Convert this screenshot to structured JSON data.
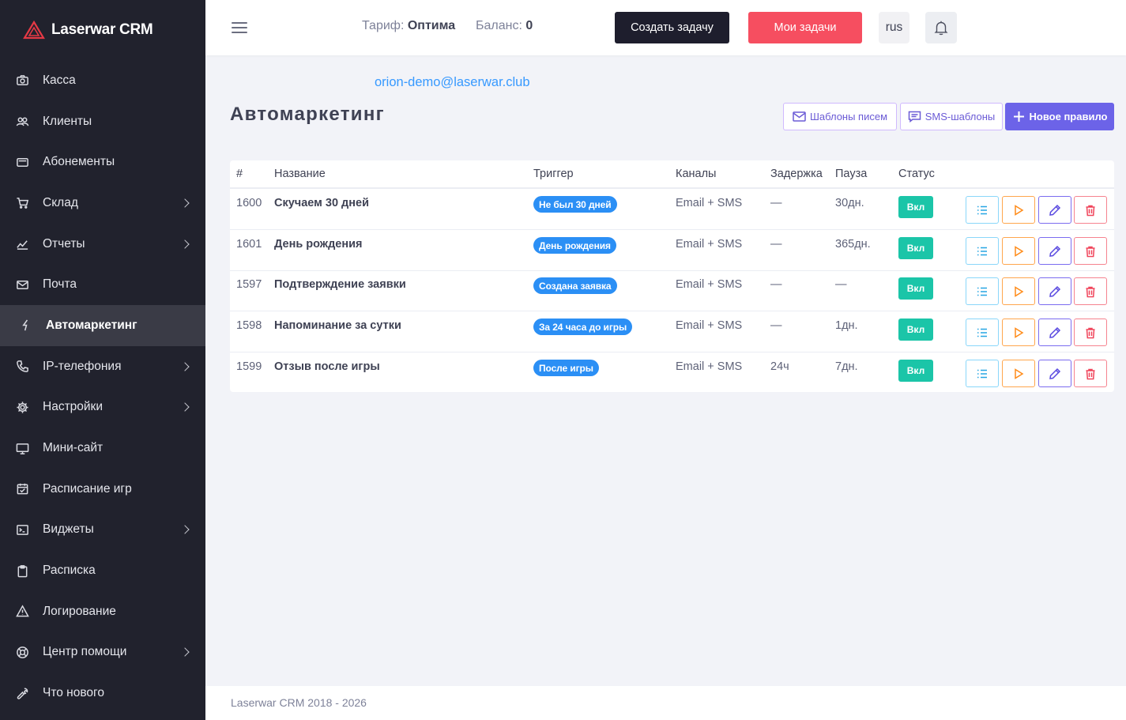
{
  "brand": {
    "name": "Laserwar CRM"
  },
  "sidebar": {
    "items": [
      {
        "label": "Касса",
        "icon": "camera-icon",
        "has_submenu": false,
        "active": false
      },
      {
        "label": "Клиенты",
        "icon": "users-icon",
        "has_submenu": false,
        "active": false
      },
      {
        "label": "Абонементы",
        "icon": "card-icon",
        "has_submenu": false,
        "active": false
      },
      {
        "label": "Склад",
        "icon": "cart-icon",
        "has_submenu": true,
        "active": false
      },
      {
        "label": "Отчеты",
        "icon": "chart-icon",
        "has_submenu": true,
        "active": false
      },
      {
        "label": "Почта",
        "icon": "mail-icon",
        "has_submenu": false,
        "active": false
      },
      {
        "label": "Автомаркетинг",
        "icon": "lightning-icon",
        "has_submenu": false,
        "active": true
      },
      {
        "label": "IP-телефония",
        "icon": "phone-icon",
        "has_submenu": true,
        "active": false
      },
      {
        "label": "Настройки",
        "icon": "gear-icon",
        "has_submenu": true,
        "active": false
      },
      {
        "label": "Мини-сайт",
        "icon": "monitor-icon",
        "has_submenu": false,
        "active": false
      },
      {
        "label": "Расписание игр",
        "icon": "calendar-check-icon",
        "has_submenu": false,
        "active": false
      },
      {
        "label": "Виджеты",
        "icon": "terminal-icon",
        "has_submenu": true,
        "active": false
      },
      {
        "label": "Расписка",
        "icon": "clipboard-icon",
        "has_submenu": false,
        "active": false
      },
      {
        "label": "Логирование",
        "icon": "warning-icon",
        "has_submenu": false,
        "active": false
      },
      {
        "label": "Центр помощи",
        "icon": "lifebuoy-icon",
        "has_submenu": true,
        "active": false
      },
      {
        "label": "Что нового",
        "icon": "wrench-icon",
        "has_submenu": false,
        "active": false
      }
    ]
  },
  "header": {
    "tariff_label": "Тариф:",
    "tariff_value": "Оптима",
    "balance_label": "Баланс:",
    "balance_value": "0",
    "create_task": "Создать задачу",
    "my_tasks": "Мои задачи",
    "lang": "rus"
  },
  "main": {
    "email": "orion-demo@laserwar.club",
    "title": "Автомаркетинг",
    "btn_letter_templates": "Шаблоны писем",
    "btn_sms_templates": "SMS-шаблоны",
    "btn_new_rule": "Новое правило"
  },
  "table": {
    "columns": [
      "#",
      "Название",
      "Триггер",
      "Каналы",
      "Задержка",
      "Пауза",
      "Статус"
    ],
    "rows": [
      {
        "id": "1600",
        "name": "Скучаем 30 дней",
        "trigger": "Не был 30 дней",
        "channels": "Email + SMS",
        "delay": "—",
        "pause": "30дн.",
        "status": "Вкл"
      },
      {
        "id": "1601",
        "name": "День рождения",
        "trigger": "День рождения",
        "channels": "Email + SMS",
        "delay": "—",
        "pause": "365дн.",
        "status": "Вкл"
      },
      {
        "id": "1597",
        "name": "Подтверждение заявки",
        "trigger": "Создана заявка",
        "channels": "Email + SMS",
        "delay": "—",
        "pause": "—",
        "status": "Вкл"
      },
      {
        "id": "1598",
        "name": "Напоминание за сутки",
        "trigger": "За 24 часа до игры",
        "channels": "Email + SMS",
        "delay": "—",
        "pause": "1дн.",
        "status": "Вкл"
      },
      {
        "id": "1599",
        "name": "Отзыв после игры",
        "trigger": "После игры",
        "channels": "Email + SMS",
        "delay": "24ч",
        "pause": "7дн.",
        "status": "Вкл"
      }
    ]
  },
  "footer": {
    "text": "Laserwar CRM 2018 - 2026"
  },
  "colors": {
    "sidebar_bg": "#21222d",
    "accent_blue": "#3699ff",
    "danger": "#f64e60",
    "primary": "#6c63e8",
    "success": "#1bc5a8"
  }
}
